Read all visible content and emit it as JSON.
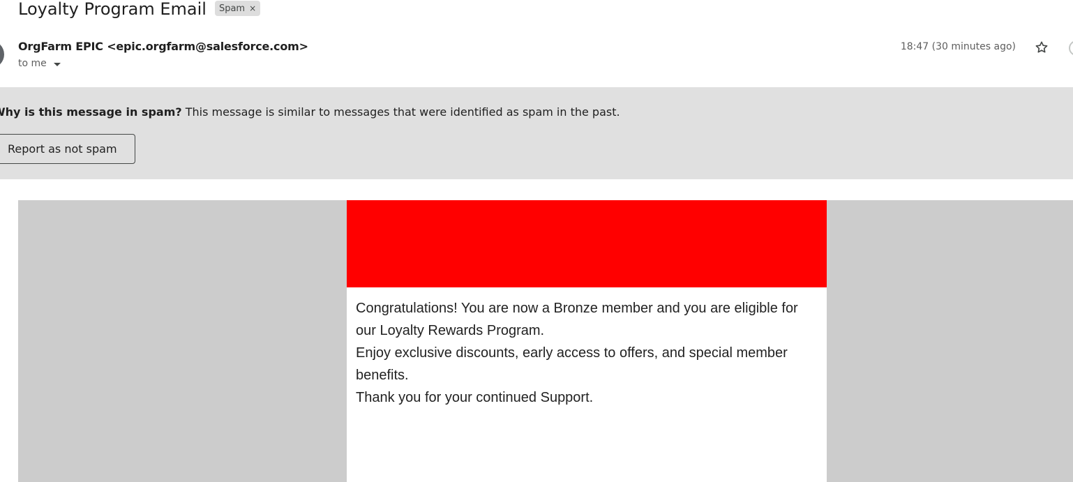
{
  "subject": "Loyalty Program Email",
  "label_chip": {
    "text": "Spam",
    "remove_glyph": "×"
  },
  "sender": {
    "display": "OrgFarm EPIC <epic.orgfarm@salesforce.com>"
  },
  "recipient": "to me",
  "timestamp": "18:47 (30 minutes ago)",
  "icons": {
    "star": "star-icon",
    "caret": "chevron-down-icon"
  },
  "spam_banner": {
    "question": "Why is this message in spam?",
    "explanation": " This message is similar to messages that were identified as spam in the past.",
    "button_label": "Report as not spam"
  },
  "email": {
    "banner_color": "#ff0000",
    "lines": [
      "Congratulations! You are now a Bronze member and you are eligible for our Loyalty Rewards Program.",
      "Enjoy exclusive discounts, early access to offers, and special member benefits.",
      "Thank you for your continued Support."
    ]
  }
}
